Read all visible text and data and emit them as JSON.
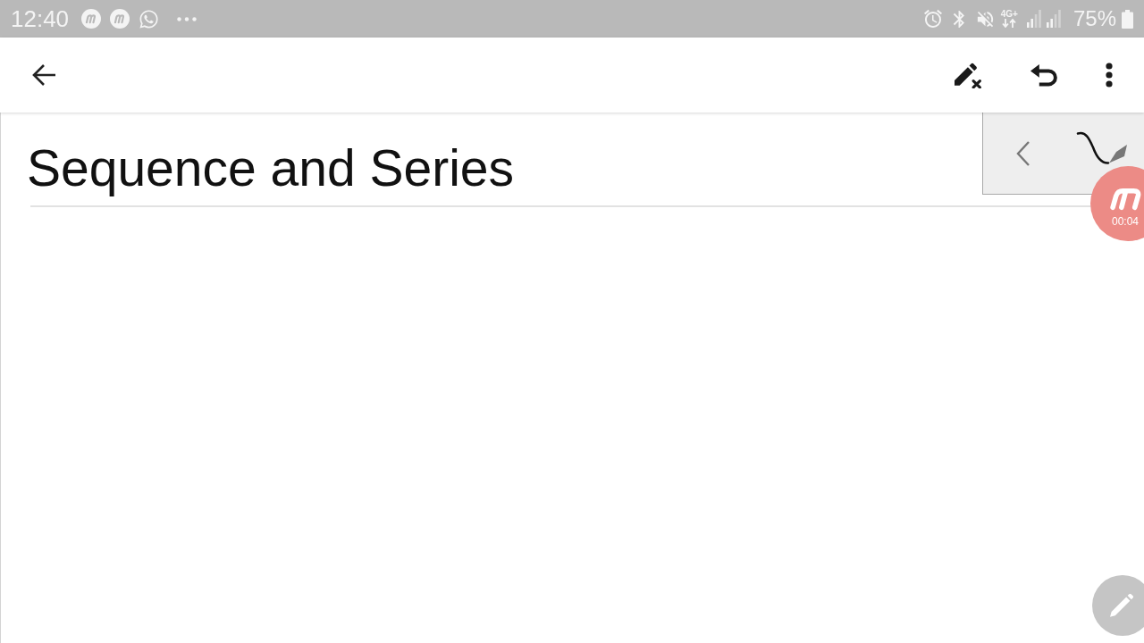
{
  "status_bar": {
    "time": "12:40",
    "network": "4G+",
    "battery": "75%"
  },
  "note": {
    "title": "Sequence and Series"
  },
  "recorder": {
    "timer": "00:04"
  }
}
